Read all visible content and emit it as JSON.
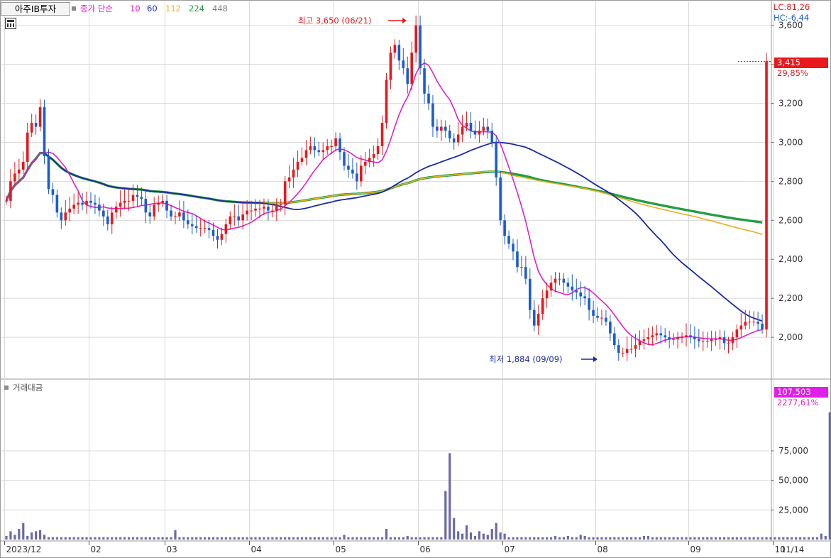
{
  "header": {
    "stock_name": "아주IB투자",
    "ma_label": "종가 단순",
    "ma_periods": [
      {
        "label": "10",
        "color": "#e020c8"
      },
      {
        "label": "60",
        "color": "#1a2aa0"
      },
      {
        "label": "112",
        "color": "#e8b020"
      },
      {
        "label": "224",
        "color": "#20a040"
      },
      {
        "label": "448",
        "color": "#808080"
      }
    ],
    "lc": "LC:81,26",
    "hc": "HC:-6,44"
  },
  "annotations": {
    "high": "최고 3,650 (06/21)",
    "low": "최저 1,884 (09/09)"
  },
  "price_panel": {
    "last_price": "3,415",
    "change_pct": "29,85%"
  },
  "volume_panel": {
    "title": "거래대금",
    "last_value": "107,503",
    "change_pct": "2277,61%"
  },
  "x_axis": {
    "labels": [
      "2023/12",
      "02",
      "03",
      "04",
      "05",
      "06",
      "07",
      "08",
      "09",
      "10",
      "11"
    ],
    "current_date": "11/14"
  },
  "colors": {
    "up": "#e8181c",
    "down": "#1a5cd0",
    "volume": "#6a6aa8",
    "grid": "#d8d8d8"
  },
  "chart_data": [
    {
      "type": "candlestick",
      "title": "아주IB투자",
      "ylim": [
        1800,
        3650
      ],
      "yticks": [
        "2,000",
        "2,200",
        "2,400",
        "2,600",
        "2,800",
        "3,000",
        "3,200",
        "3,400",
        "3,600"
      ],
      "ytick_values": [
        2000,
        2200,
        2400,
        2600,
        2800,
        3000,
        3200,
        3400,
        3600
      ],
      "high": {
        "value": 3650,
        "date": "06/21"
      },
      "low": {
        "value": 1884,
        "date": "09/09"
      },
      "last_close": 3415,
      "months": [
        "2023/12",
        "02",
        "03",
        "04",
        "05",
        "06",
        "07",
        "08",
        "09",
        "10",
        "11"
      ],
      "month_starts": [
        0,
        20,
        38,
        58,
        78,
        98,
        118,
        140,
        162,
        182,
        200
      ],
      "close": [
        2700,
        2800,
        2840,
        2860,
        2900,
        3050,
        3100,
        3080,
        3180,
        2930,
        2760,
        2730,
        2640,
        2600,
        2640,
        2660,
        2680,
        2690,
        2680,
        2700,
        2690,
        2680,
        2650,
        2620,
        2580,
        2640,
        2670,
        2690,
        2700,
        2700,
        2730,
        2720,
        2710,
        2640,
        2620,
        2680,
        2690,
        2700,
        2650,
        2620,
        2620,
        2640,
        2600,
        2580,
        2570,
        2560,
        2560,
        2560,
        2550,
        2520,
        2500,
        2530,
        2580,
        2620,
        2620,
        2600,
        2630,
        2650,
        2650,
        2660,
        2660,
        2670,
        2650,
        2650,
        2680,
        2680,
        2800,
        2820,
        2860,
        2900,
        2920,
        2960,
        2980,
        2960,
        2950,
        2960,
        2980,
        2980,
        3020,
        2950,
        2880,
        2860,
        2840,
        2800,
        2880,
        2900,
        2920,
        2940,
        2980,
        3100,
        3320,
        3460,
        3500,
        3420,
        3380,
        3300,
        3460,
        3600,
        3380,
        3250,
        3200,
        3080,
        3060,
        3080,
        3060,
        3020,
        3000,
        3040,
        3080,
        3100,
        3060,
        3040,
        3060,
        3080,
        3060,
        3000,
        2820,
        2600,
        2520,
        2480,
        2440,
        2360,
        2360,
        2300,
        2140,
        2060,
        2120,
        2200,
        2240,
        2280,
        2300,
        2300,
        2280,
        2260,
        2240,
        2230,
        2210,
        2200,
        2140,
        2110,
        2100,
        2100,
        2080,
        2020,
        1960,
        1920,
        1920,
        1940,
        1940,
        1960,
        1980,
        1990,
        2000,
        2010,
        2020,
        2010,
        2000,
        1990,
        1990,
        2000,
        2000,
        2010,
        2000,
        1990,
        1980,
        1980,
        1980,
        1990,
        1990,
        2000,
        1970,
        1970,
        2000,
        2040,
        2060,
        2080,
        2080,
        2080,
        2070,
        2040,
        3415
      ],
      "ma_series": [
        {
          "name": "10",
          "color": "#e020c8"
        },
        {
          "name": "60",
          "color": "#1a2aa0"
        },
        {
          "name": "112",
          "color": "#e8b020"
        },
        {
          "name": "224",
          "color": "#20a040"
        },
        {
          "name": "448",
          "color": "#808080"
        }
      ]
    },
    {
      "type": "bar",
      "title": "거래대금",
      "ylim": [
        0,
        120000
      ],
      "yticks": [
        "25,000",
        "50,000",
        "75,000"
      ],
      "ytick_values": [
        25000,
        50000,
        75000
      ],
      "last_value": 107503,
      "values": [
        3000,
        7000,
        4000,
        9000,
        14000,
        3000,
        6000,
        7000,
        8000,
        4000,
        2000,
        2000,
        2000,
        2000,
        2000,
        2000,
        2000,
        2000,
        2000,
        2000,
        2000,
        2000,
        2000,
        2000,
        2000,
        2000,
        2000,
        2000,
        2000,
        2000,
        2000,
        2000,
        2000,
        2000,
        2000,
        2000,
        2000,
        2000,
        2000,
        2000,
        8000,
        2000,
        2000,
        2000,
        2000,
        2000,
        2000,
        2000,
        2000,
        2000,
        2000,
        2000,
        2000,
        2000,
        2000,
        2000,
        2000,
        2000,
        2000,
        2000,
        2000,
        2000,
        2000,
        2000,
        2000,
        2000,
        2000,
        2000,
        2000,
        2000,
        2000,
        2000,
        2000,
        2000,
        2000,
        2000,
        2000,
        2000,
        2000,
        2000,
        4000,
        2000,
        2000,
        2000,
        2000,
        2000,
        2000,
        2000,
        2000,
        2000,
        9000,
        2000,
        2000,
        2000,
        2000,
        3000,
        2000,
        2000,
        2000,
        2000,
        2000,
        2000,
        2000,
        2000,
        41000,
        73000,
        18000,
        7000,
        5000,
        12000,
        6000,
        3000,
        7000,
        5000,
        4000,
        9000,
        14000,
        6000,
        5000,
        2000,
        2000,
        2000,
        2000,
        2000,
        2000,
        2000,
        2000,
        2000,
        2000,
        2000,
        3000,
        2000,
        2000,
        3000,
        2000,
        2000,
        4000,
        3000,
        2000,
        2000,
        2000,
        2000,
        2000,
        2000,
        2000,
        2000,
        2000,
        2000,
        2000,
        2000,
        2000,
        3000,
        3000,
        2000,
        2000,
        2000,
        2000,
        2000,
        2000,
        2000,
        2000,
        2000,
        2000,
        2000,
        2000,
        2000,
        2000,
        2000,
        2000,
        2000,
        2000,
        2000,
        2000,
        2000,
        2000,
        2000,
        2000,
        2000,
        2000,
        2000,
        2000,
        2000,
        2000,
        2000,
        2000,
        2000,
        2000,
        2000,
        2000,
        2000,
        2000,
        2000,
        2000,
        5000,
        3000,
        107503
      ]
    }
  ]
}
